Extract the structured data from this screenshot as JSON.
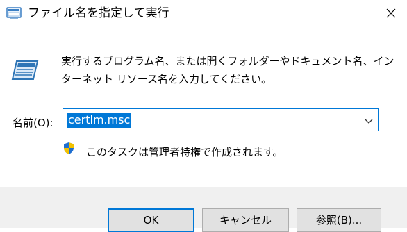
{
  "window": {
    "title": "ファイル名を指定して実行",
    "close_icon": "close-icon"
  },
  "main": {
    "description": "実行するプログラム名、または開くフォルダーやドキュメント名、インターネット リソース名を入力してください。",
    "run_icon": "run-dialog-icon"
  },
  "open_field": {
    "label": "名前(O):",
    "value": "certlm.msc",
    "dropdown_icon": "chevron-down-icon"
  },
  "admin_notice": {
    "text": "このタスクは管理者特権で作成されます。",
    "icon": "shield-icon"
  },
  "buttons": {
    "ok": "OK",
    "cancel": "キャンセル",
    "browse": "参照(B)..."
  },
  "colors": {
    "accent": "#0078d7",
    "footer_bg": "#f0f0f0",
    "button_bg": "#e1e1e1"
  }
}
